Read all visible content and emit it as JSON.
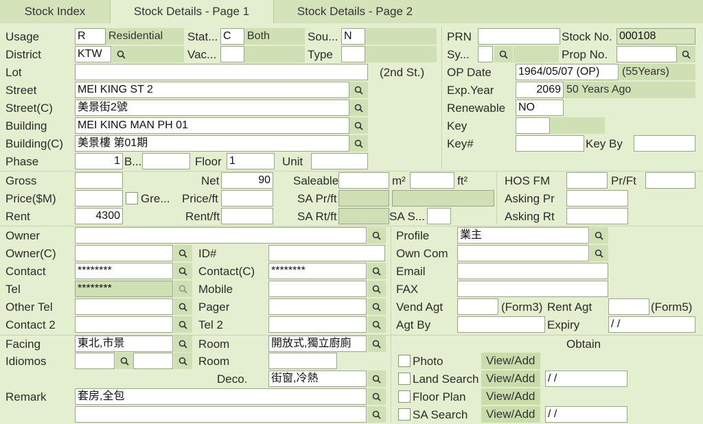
{
  "tabs": [
    "Stock Index",
    "Stock Details - Page 1",
    "Stock Details - Page 2"
  ],
  "active_tab": 1,
  "colors": {
    "background": "#e4efcf",
    "readonly": "#cfe0b4",
    "tabbar": "#d5e3ba",
    "active_tab": "#e4efcf"
  },
  "icons": {
    "search": "search-icon",
    "checkbox": "checkbox-icon"
  },
  "labels": {
    "usage": "Usage",
    "district": "District",
    "lot": "Lot",
    "street": "Street",
    "street_c": "Street(C)",
    "building": "Building",
    "building_c": "Building(C)",
    "phase": "Phase",
    "block": "B...",
    "floor": "Floor",
    "unit": "Unit",
    "status": "Stat...",
    "vacant": "Vac...",
    "source": "Sou...",
    "type": "Type",
    "second_st": "(2nd St.)",
    "prn": "PRN",
    "stock_no": "Stock No.",
    "sy": "Sy...",
    "prop_no": "Prop No.",
    "op_date": "OP Date",
    "exp_year": "Exp.Year",
    "renewable": "Renewable",
    "key": "Key",
    "key_no": "Key#",
    "key_by": "Key By",
    "gross": "Gross",
    "net": "Net",
    "saleable": "Saleable",
    "m2": "m²",
    "ft2": "ft²",
    "hos_fm": "HOS FM",
    "pr_ft": "Pr/Ft",
    "price": "Price($M)",
    "gre": "Gre...",
    "price_ft": "Price/ft",
    "sa_pr_ft": "SA Pr/ft",
    "asking_pr": "Asking Pr",
    "rent": "Rent",
    "rent_ft": "Rent/ft",
    "sa_rt_ft": "SA Rt/ft",
    "sa_s": "SA S...",
    "asking_rt": "Asking Rt",
    "owner": "Owner",
    "owner_c": "Owner(C)",
    "id": "ID#",
    "contact": "Contact",
    "contact_c": "Contact(C)",
    "tel": "Tel",
    "mobile": "Mobile",
    "other_tel": "Other Tel",
    "pager": "Pager",
    "contact2": "Contact 2",
    "tel2": "Tel 2",
    "profile": "Profile",
    "own_com": "Own Com",
    "email": "Email",
    "fax": "FAX",
    "vend_agt": "Vend Agt",
    "form3": "(Form3)",
    "rent_agt": "Rent Agt",
    "form5": "(Form5)",
    "agt_by": "Agt By",
    "expiry": "Expiry",
    "facing": "Facing",
    "idiomos": "Idiomos",
    "room": "Room",
    "room2": "Room",
    "deco": "Deco.",
    "remark": "Remark",
    "obtain": "Obtain",
    "photo": "Photo",
    "land_search": "Land Search",
    "floor_plan": "Floor Plan",
    "sa_search": "SA Search",
    "view_add": "View/Add"
  },
  "values": {
    "usage": "R",
    "usage_desc": "Residential",
    "status": "C",
    "status_desc": "Both",
    "source": "N",
    "district": "KTW",
    "vacant": "",
    "type": "",
    "lot": "",
    "street": "MEI KING ST 2",
    "street_c": "美景街2號",
    "building": "MEI KING MAN PH 01",
    "building_c": "美景樓 第01期",
    "phase": "1",
    "block": "",
    "floor": "1",
    "unit": "",
    "prn": "",
    "stock_no": "000108",
    "sy": "",
    "prop_no": "",
    "op_date": "1964/05/07 (OP)",
    "op_years": "(55Years)",
    "exp_year": "2069",
    "exp_desc": "50 Years Ago",
    "renewable": "NO",
    "key": "",
    "key_no": "",
    "key_by": "",
    "gross": "",
    "net": "90",
    "saleable": "",
    "m2": "",
    "hos_fm": "",
    "pr_ft": "",
    "price": "",
    "price_ft": "",
    "asking_pr": "",
    "rent": "4300",
    "rent_ft": "",
    "sa_s": "",
    "asking_rt": "",
    "owner": "",
    "owner_c": "",
    "id": "",
    "contact": "********",
    "contact_c": "********",
    "tel": "********",
    "mobile": "",
    "other_tel": "",
    "pager": "",
    "contact2": "",
    "tel2": "",
    "profile": "業主",
    "own_com": "",
    "email": "",
    "fax": "",
    "vend_agt": "",
    "rent_agt": "",
    "agt_by": "",
    "expiry": " / /",
    "facing": "東北,市景",
    "idiomos": "",
    "idiomos2": "",
    "room": "開放式,獨立廚廁",
    "room2": "",
    "deco": "街窗,冷熱",
    "remark": "套房,全包",
    "remark2": "",
    "land_search_date": " / /",
    "sa_search_date": " / /"
  }
}
